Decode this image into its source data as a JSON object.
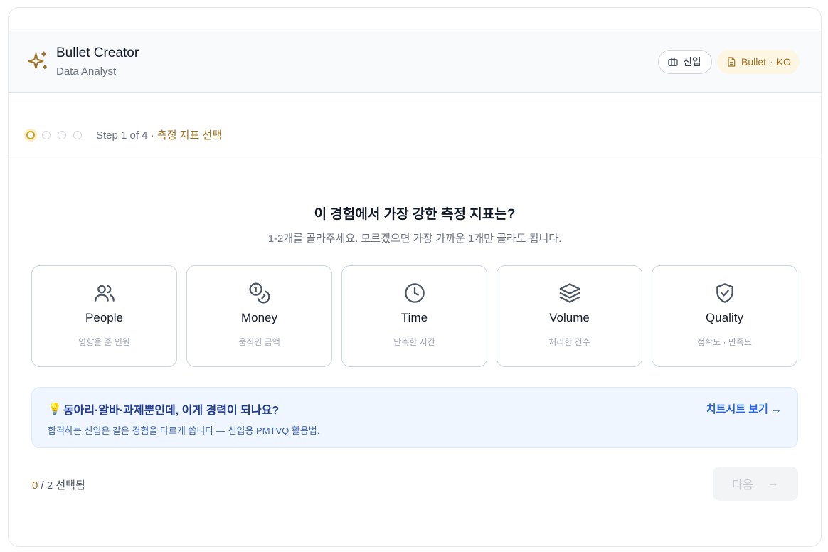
{
  "header": {
    "title": "Bullet Creator",
    "subtitle": "Data Analyst",
    "level_label": "신입",
    "doc_type": "Bullet",
    "doc_sep": "·",
    "doc_lang": "KO"
  },
  "stepper": {
    "current": 1,
    "total": 4,
    "text": "Step 1 of 4 · ",
    "step_name": "측정 지표 선택"
  },
  "question": {
    "title": "이 경험에서 가장 강한 측정 지표는?",
    "hint": "1-2개를 골라주세요. 모르겠으면 가장 가까운 1개만 골라도 됩니다."
  },
  "metrics": [
    {
      "label": "People",
      "desc": "영향을 준 인원",
      "icon": "users-icon"
    },
    {
      "label": "Money",
      "desc": "움직인 금액",
      "icon": "coins-icon"
    },
    {
      "label": "Time",
      "desc": "단축한 시간",
      "icon": "clock-icon"
    },
    {
      "label": "Volume",
      "desc": "처리한 건수",
      "icon": "layers-icon"
    },
    {
      "label": "Quality",
      "desc": "정확도 · 만족도",
      "icon": "shield-check-icon"
    }
  ],
  "banner": {
    "icon": "💡",
    "title": "동아리·알바·과제뿐인데, 이게 경력이 되나요?",
    "subtitle": "합격하는 신입은 같은 경험을 다르게 씁니다 — 신입용 PMTVQ 활용법.",
    "link": "치트시트 보기 →"
  },
  "footer": {
    "selected_count": "0",
    "selected_rest": " / 2 선택됨",
    "next_label": "다음",
    "next_arrow": "→"
  },
  "colors": {
    "accent": "#a0701e",
    "link": "#2563eb",
    "banner_bg": "#eff6ff"
  }
}
